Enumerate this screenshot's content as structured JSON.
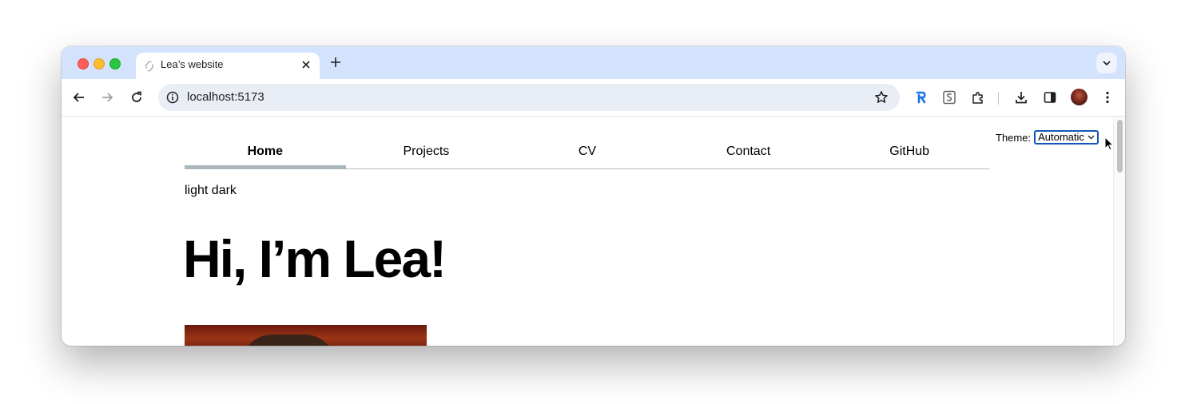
{
  "browser": {
    "tab": {
      "title": "Lea’s website"
    },
    "address": {
      "url": "localhost:5173"
    }
  },
  "page": {
    "theme": {
      "label": "Theme:",
      "selected": "Automatic"
    },
    "nav": [
      {
        "label": "Home",
        "active": true
      },
      {
        "label": "Projects",
        "active": false
      },
      {
        "label": "CV",
        "active": false
      },
      {
        "label": "Contact",
        "active": false
      },
      {
        "label": "GitHub",
        "active": false
      }
    ],
    "color_scheme_text": "light dark",
    "heading": "Hi, I’m Lea!"
  },
  "colors": {
    "tabstrip": "#d3e3fd",
    "nav_active_underline": "#aab6bd",
    "select_focus": "#1456b8"
  }
}
